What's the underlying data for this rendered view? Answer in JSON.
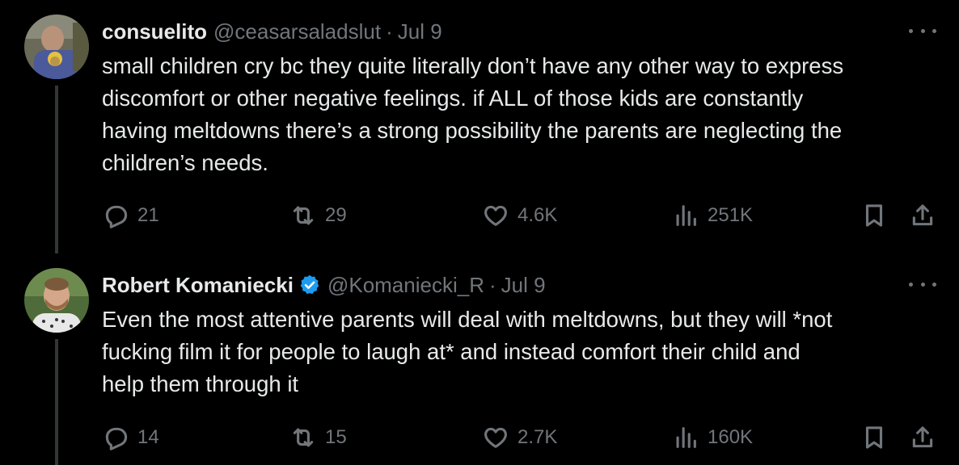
{
  "tweets": [
    {
      "display_name": "consuelito",
      "handle": "@ceasarsaladslut",
      "separator": "·",
      "date": "Jul 9",
      "verified": false,
      "text": "small children cry bc they quite literally don’t have any other way to express\ndiscomfort or other negative feelings. if ALL of those kids are constantly\nhaving meltdowns there’s a strong possibility the parents are neglecting the\nchildren’s needs.",
      "replies": "21",
      "reposts": "29",
      "likes": "4.6K",
      "views": "251K"
    },
    {
      "display_name": "Robert Komaniecki",
      "handle": "@Komaniecki_R",
      "separator": "·",
      "date": "Jul 9",
      "verified": true,
      "text": "Even the most attentive parents will deal with meltdowns, but they will *not\nfucking film it for people to laugh at* and instead comfort their child and\nhelp them through it",
      "replies": "14",
      "reposts": "15",
      "likes": "2.7K",
      "views": "160K"
    }
  ],
  "colors": {
    "background": "#000000",
    "text": "#e7e9ea",
    "muted": "#71767b",
    "thread_line": "#333639",
    "verified": "#1d9bf0"
  },
  "icons": [
    "reply-icon",
    "repost-icon",
    "like-icon",
    "views-icon",
    "bookmark-icon",
    "share-icon",
    "more-icon",
    "verified-icon"
  ]
}
